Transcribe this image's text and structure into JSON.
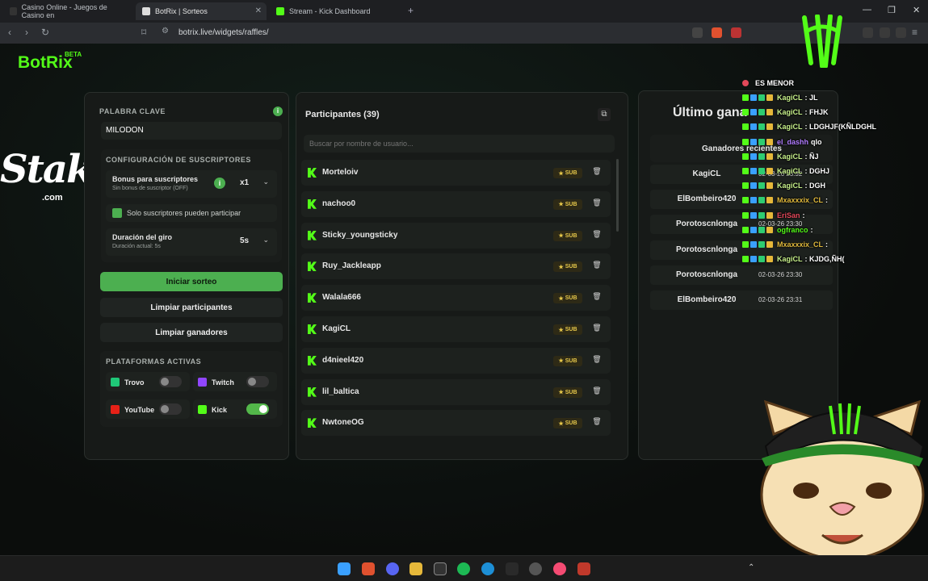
{
  "browser": {
    "tabs": [
      {
        "title": "Casino Online - Juegos de Casino en"
      },
      {
        "title": "BotRix | Sorteos"
      },
      {
        "title": "Stream - Kick Dashboard"
      }
    ],
    "url": "botrix.live/widgets/raffles/"
  },
  "brand": {
    "logo": "BotRix",
    "badge": "BETA",
    "overlay_logo": "Stake",
    "overlay_logo_sub": ".com"
  },
  "settings": {
    "keyword_label": "PALABRA CLAVE",
    "keyword_value": "MILODON",
    "subs_section": "CONFIGURACIÓN DE SUSCRIPTORES",
    "bonus_label": "Bonus para suscriptores",
    "bonus_sub": "Sin bonus de suscriptor (OFF)",
    "bonus_value": "x1",
    "subs_only_label": "Solo suscriptores pueden participar",
    "spin_label": "Duración del giro",
    "spin_sub": "Duración actual: 5s",
    "spin_value": "5s",
    "start_button": "Iniciar sorteo",
    "clear_participants_button": "Limpiar participantes",
    "clear_winners_button": "Limpiar ganadores",
    "platforms_section": "PLATAFORMAS ACTIVAS",
    "platforms": [
      {
        "name": "Trovo",
        "enabled": false
      },
      {
        "name": "Twitch",
        "enabled": false
      },
      {
        "name": "YouTube",
        "enabled": false
      },
      {
        "name": "Kick",
        "enabled": true
      }
    ]
  },
  "participants": {
    "title": "Participantes (39)",
    "search_placeholder": "Buscar por nombre de usuario...",
    "badge": "SUB",
    "list": [
      "Morteloiv",
      "nachoo0",
      "Sticky_youngsticky",
      "Ruy_Jackleapp",
      "Walala666",
      "KagiCL",
      "d4nieel420",
      "lil_baltica",
      "NwtoneOG"
    ]
  },
  "winners": {
    "title": "Último gana",
    "recent_label": "Ganadores recientes",
    "list": [
      {
        "name": "KagiCL",
        "date": "02-03-26 23:32"
      },
      {
        "name": "ElBombeiro420",
        "date": ""
      },
      {
        "name": "Porotoscnlonga",
        "date": "02-03-26 23:30"
      },
      {
        "name": "Porotoscnlonga",
        "date": ""
      },
      {
        "name": "Porotoscnlonga",
        "date": "02-03-26 23:30"
      },
      {
        "name": "ElBombeiro420",
        "date": "02-03-26 23:31"
      }
    ]
  },
  "chat_overlay": [
    {
      "user": "",
      "message": "ES MENOR",
      "color": "#ffffff"
    },
    {
      "user": "KagiCL",
      "message": ": JL",
      "color": "#c7f08a"
    },
    {
      "user": "KagiCL",
      "message": ": FHJK",
      "color": "#c7f08a"
    },
    {
      "user": "KagiCL",
      "message": ": LDGHJF(KÑLDGHL",
      "color": "#c7f08a"
    },
    {
      "user": "el_dashh",
      "message": "qlo",
      "color": "#b07cff"
    },
    {
      "user": "KagiCL",
      "message": ": ÑJ",
      "color": "#c7f08a"
    },
    {
      "user": "KagiCL",
      "message": ": DGHJ",
      "color": "#c7f08a"
    },
    {
      "user": "KagiCL",
      "message": ": DGH",
      "color": "#c7f08a"
    },
    {
      "user": "Mxaxxxix_CL",
      "message": ":",
      "color": "#e0b93c"
    },
    {
      "user": "EriSan",
      "message": ":",
      "color": "#e3485a"
    },
    {
      "user": "ogfranco",
      "message": ":",
      "color": "#53fc18"
    },
    {
      "user": "Mxaxxxix_CL",
      "message": ":",
      "color": "#e0b93c"
    },
    {
      "user": "KagiCL",
      "message": ": KJDG,ÑH(",
      "color": "#c7f08a"
    }
  ],
  "colors": {
    "accent": "#53fc18",
    "start_button": "#4caf50",
    "card_bg": "#171a18"
  },
  "icons": [
    "kick-icon",
    "info-icon",
    "copy-icon",
    "trash-icon",
    "star-icon",
    "chevron-down-icon"
  ]
}
